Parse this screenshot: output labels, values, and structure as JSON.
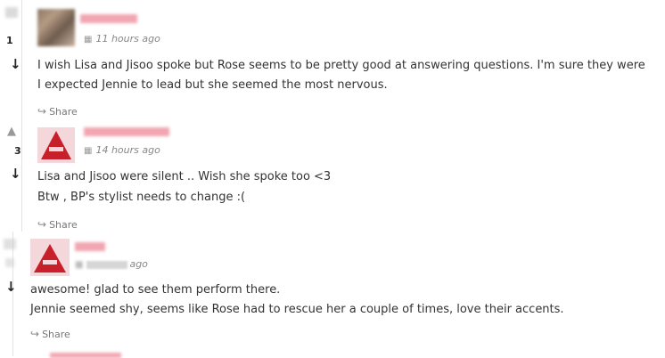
{
  "comments": [
    {
      "vote_count": "1",
      "timestamp": "11 hours ago",
      "lines": [
        "I wish Lisa and Jisoo spoke but Rose seems to be pretty good at answering questions. I'm sure they were",
        "I expected Jennie to lead but she seemed the most nervous."
      ],
      "share_label": "Share"
    },
    {
      "vote_count": "3",
      "timestamp": "14 hours ago",
      "lines": [
        "Lisa and Jisoo were silent .. Wish she spoke too <3",
        "Btw , BP's stylist needs to change :("
      ],
      "share_label": "Share"
    },
    {
      "vote_count": "",
      "timestamp": "ago",
      "lines": [
        "awesome! glad to see them perform there.",
        "Jennie seemed shy, seems like Rose had to rescue her a couple of times, love their accents."
      ],
      "share_label": "Share"
    }
  ],
  "icons": {
    "upvote": "arrow-up-icon",
    "downvote": "arrow-down-icon",
    "calendar": "calendar-icon",
    "share": "share-icon"
  },
  "colors": {
    "avatar_red": "#c8202a",
    "username_pink": "#e46b7a",
    "thread_line": "#e3e3e3"
  }
}
